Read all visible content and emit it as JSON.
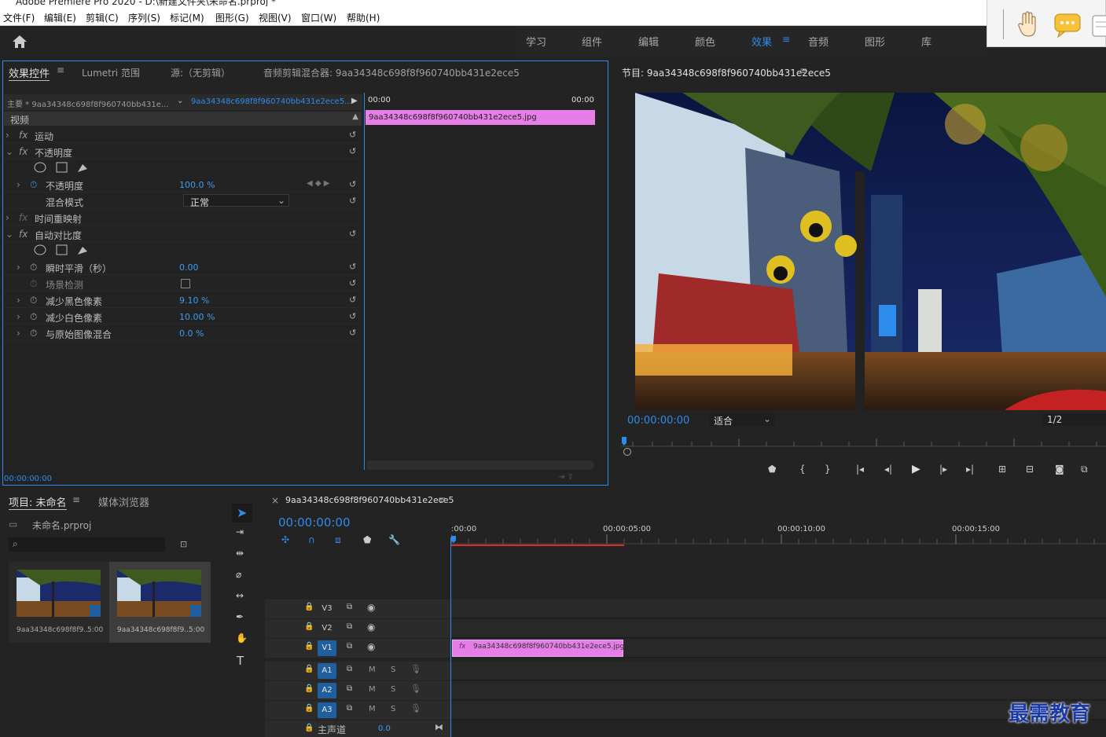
{
  "app": {
    "title": "Adobe Premiere Pro 2020 - D:\\新建文件夹\\未命名.prproj *"
  },
  "menu": [
    "文件(F)",
    "编辑(E)",
    "剪辑(C)",
    "序列(S)",
    "标记(M)",
    "图形(G)",
    "视图(V)",
    "窗口(W)",
    "帮助(H)"
  ],
  "workspaces": [
    "学习",
    "组件",
    "编辑",
    "颜色",
    "效果",
    "音频",
    "图形",
    "库"
  ],
  "active_workspace": "效果",
  "effect_controls": {
    "tabs": [
      "效果控件",
      "Lumetri 范围",
      "源:（无剪辑）",
      "音频剪辑混合器: 9aa34348c698f8f960740bb431e2ece5"
    ],
    "master": "主要 * 9aa34348c698f8f960740bb431e...",
    "clip": "9aa34348c698f8f960740bb431e2ece5...",
    "time_start": "00:00",
    "time_end": "00:00",
    "clip_file": "9aa34348c698f8f960740bb431e2ece5.jpg",
    "video_header": "视频",
    "rows": [
      {
        "label": "运动"
      },
      {
        "label": "不透明度"
      },
      {
        "label": "不透明度",
        "value": "100.0 %"
      },
      {
        "label": "混合模式",
        "value": "正常"
      },
      {
        "label": "时间重映射"
      },
      {
        "label": "自动对比度"
      },
      {
        "label": "瞬时平滑（秒）",
        "value": "0.00"
      },
      {
        "label": "场景检测"
      },
      {
        "label": "减少黑色像素",
        "value": "9.10 %"
      },
      {
        "label": "减少白色像素",
        "value": "10.00 %"
      },
      {
        "label": "与原始图像混合",
        "value": "0.0 %"
      }
    ],
    "timecode": "00:00:00:00"
  },
  "program": {
    "title": "节目: 9aa34348c698f8f960740bb431e2ece5",
    "timecode": "00:00:00:00",
    "fit": "适合",
    "resolution": "1/2"
  },
  "project": {
    "tabs": [
      "项目: 未命名",
      "媒体浏览器"
    ],
    "file": "未命名.prproj",
    "items": [
      {
        "name": "9aa34348c698f8f9...",
        "duration": "5:00"
      },
      {
        "name": "9aa34348c698f8f9...",
        "duration": "5:00"
      }
    ]
  },
  "timeline": {
    "title": "9aa34348c698f8f960740bb431e2ece5",
    "timecode": "00:00:00:00",
    "ruler": [
      ":00:00",
      "00:00:05:00",
      "00:00:10:00",
      "00:00:15:00"
    ],
    "video_tracks": [
      "V3",
      "V2",
      "V1"
    ],
    "audio_tracks": [
      "A1",
      "A2",
      "A3"
    ],
    "mute": "M",
    "solo": "S",
    "master_label": "主声道",
    "master_value": "0.0",
    "clip": "9aa34348c698f8f960740bb431e2ece5.jpg"
  },
  "watermark": "最需教育",
  "colors": {
    "accent": "#2d8ceb",
    "clip": "#e57ee6",
    "playhead": "#2d8ceb",
    "worktrack": "#d9302c"
  }
}
